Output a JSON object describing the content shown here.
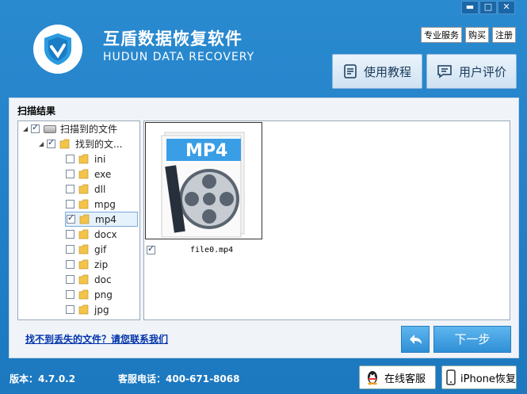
{
  "window_controls": {
    "minimize": "▬",
    "maximize": "□",
    "close": "✕"
  },
  "header": {
    "title_cn": "互盾数据恢复软件",
    "title_en": "HUDUN DATA RECOVERY",
    "top_links": [
      "专业服务",
      "购买",
      "注册"
    ],
    "tutorial_button": "使用教程",
    "review_button": "用户评价"
  },
  "panel": {
    "title": "扫描结果",
    "tree": {
      "root": {
        "label": "扫描到的文件",
        "checked": true
      },
      "child": {
        "label": "找到的文...",
        "checked": true
      },
      "items": [
        {
          "label": "ini",
          "checked": false
        },
        {
          "label": "exe",
          "checked": false
        },
        {
          "label": "dll",
          "checked": false
        },
        {
          "label": "mpg",
          "checked": false
        },
        {
          "label": "mp4",
          "checked": true,
          "selected": true
        },
        {
          "label": "docx",
          "checked": false
        },
        {
          "label": "gif",
          "checked": false
        },
        {
          "label": "zip",
          "checked": false
        },
        {
          "label": "doc",
          "checked": false
        },
        {
          "label": "png",
          "checked": false
        },
        {
          "label": "jpg",
          "checked": false
        }
      ]
    },
    "file": {
      "thumb_text": "MP4",
      "name": "file0.mp4",
      "checked": true
    },
    "help_link": "找不到丢失的文件？请您联系我们",
    "back_button_icon": "undo-arrow-icon",
    "next_button": "下一步"
  },
  "footer": {
    "version": "版本：4.7.0.2",
    "phone": "客服电话：400-671-8068",
    "online_service": "在线客服",
    "iphone_recovery": "iPhone恢复"
  }
}
